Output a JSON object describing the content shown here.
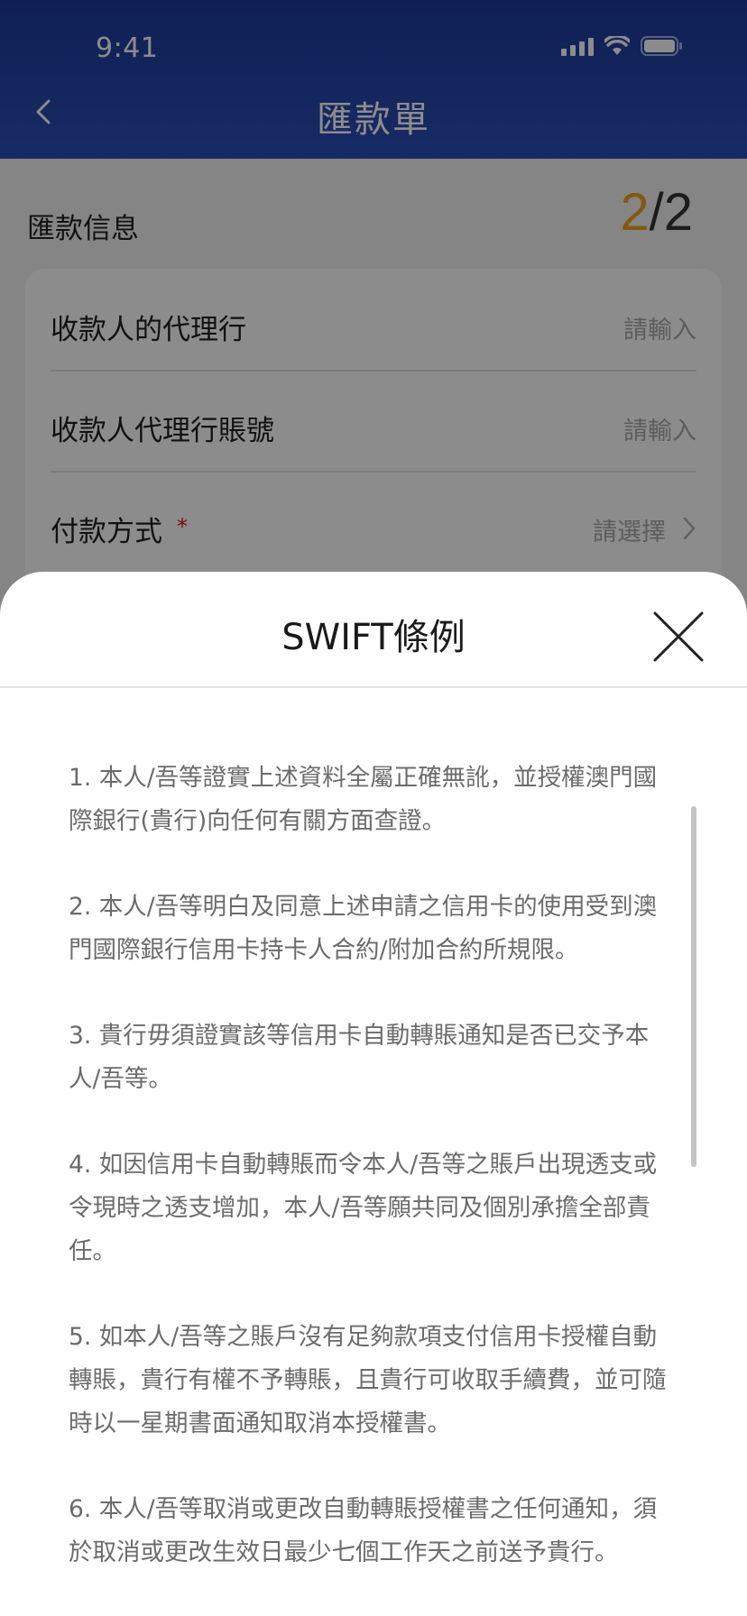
{
  "status_bar": {
    "time": "9:41"
  },
  "header": {
    "title": "匯款單"
  },
  "section": {
    "title": "匯款信息",
    "step_current": "2",
    "step_total": "/2"
  },
  "form": {
    "rows": [
      {
        "label": "收款人的代理行",
        "value": "請輸入",
        "required": false
      },
      {
        "label": "收款人代理行賬號",
        "value": "請輸入",
        "required": false
      },
      {
        "label": "付款方式",
        "value": "請選擇",
        "required": true,
        "required_mark": "*"
      }
    ]
  },
  "sheet": {
    "title": "SWIFT條例",
    "terms": [
      "1. 本人/吾等證實上述資料全屬正確無訛，並授權澳門國際銀行(貴行)向任何有關方面查證。",
      "2. 本人/吾等明白及同意上述申請之信用卡的使用受到澳門國際銀行信用卡持卡人合約/附加合約所規限。",
      "3. 貴行毋須證實該等信用卡自動轉賬通知是否已交予本人/吾等。",
      "4. 如因信用卡自動轉賬而令本人/吾等之賬戶出現透支或令現時之透支增加，本人/吾等願共同及個別承擔全部責任。",
      "5. 如本人/吾等之賬戶沒有足夠款項支付信用卡授權自動轉賬，貴行有權不予轉賬，且貴行可收取手續費，並可隨時以一星期書面通知取消本授權書。",
      "6. 本人/吾等取消或更改自動轉賬授權書之任何通知，須於取消或更改生效日最少七個工作天之前送予貴行。"
    ]
  },
  "colors": {
    "header_top": "#1d3a9c",
    "header_bottom": "#2d4fb8",
    "step_accent": "#f0a024",
    "required": "#d21a1a"
  }
}
